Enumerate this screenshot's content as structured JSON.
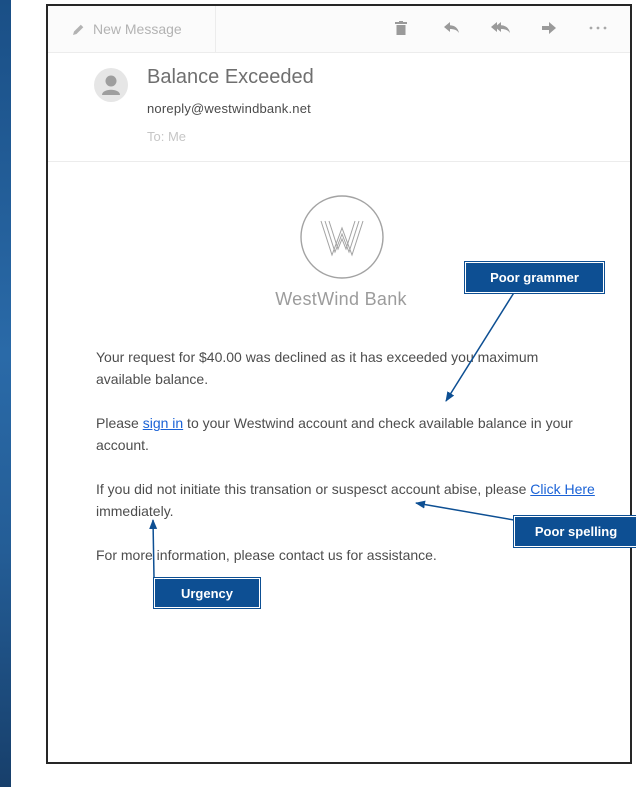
{
  "toolbar": {
    "new_message_label": "New Message",
    "icons": [
      "pencil-icon",
      "trash-icon",
      "reply-icon",
      "reply-all-icon",
      "forward-icon",
      "more-icon"
    ]
  },
  "email": {
    "subject": "Balance Exceeded",
    "sender": "noreply@westwindbank.net",
    "to_line": "To: Me"
  },
  "body": {
    "bank_name": "WestWind Bank",
    "p1": "Your request for $40.00 was declined as it has exceeded you maximum available balance.",
    "p2_before": "Please ",
    "p2_link": "sign in",
    "p2_after": " to your Westwind account and check available balance in your account.",
    "p3_before": "If you did not initiate this transation or suspesct account abise, please ",
    "p3_link": "Click Here",
    "p3_after": " immediately.",
    "p4": "For more information, please contact us for assistance."
  },
  "annotations": {
    "grammar": "Poor grammer",
    "spelling": "Poor spelling",
    "urgency": "Urgency"
  },
  "colors": {
    "callout_bg": "#0d4f93",
    "link": "#1a62d6",
    "window_border": "#262626",
    "desktop_strip": "#2a6aa8"
  }
}
